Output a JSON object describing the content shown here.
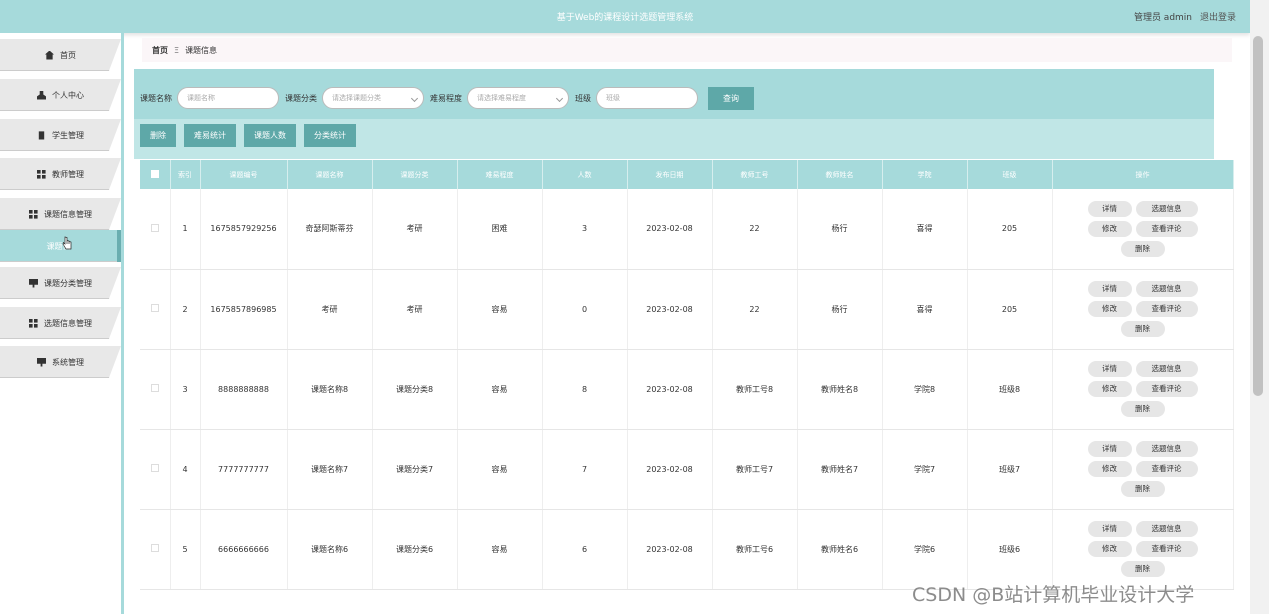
{
  "header": {
    "title": "基于Web的课程设计选题管理系统",
    "admin_label": "管理员 admin",
    "logout": "退出登录"
  },
  "sidebar": {
    "items": [
      {
        "label": "首页",
        "icon": "home-icon"
      },
      {
        "label": "个人中心",
        "icon": "user-icon"
      },
      {
        "label": "学生管理",
        "icon": "clipboard-icon"
      },
      {
        "label": "教师管理",
        "icon": "grid-icon"
      },
      {
        "label": "课题信息管理",
        "icon": "grid-icon"
      },
      {
        "label": "课题信",
        "icon": ""
      },
      {
        "label": "课题分类管理",
        "icon": "monitor-icon"
      },
      {
        "label": "选题信息管理",
        "icon": "grid-icon"
      },
      {
        "label": "系统管理",
        "icon": "monitor-icon"
      }
    ]
  },
  "breadcrumb": {
    "home": "首页",
    "sep": "Ξ",
    "current": "课题信息"
  },
  "search": {
    "name_label": "课题名称",
    "name_placeholder": "课题名称",
    "category_label": "课题分类",
    "category_placeholder": "请选择课题分类",
    "difficulty_label": "难易程度",
    "difficulty_placeholder": "请选择难易程度",
    "class_label": "班级",
    "class_placeholder": "班级",
    "query": "查询"
  },
  "actions": {
    "delete": "删除",
    "difficulty_stats": "难易统计",
    "topic_count": "课题人数",
    "category_stats": "分类统计"
  },
  "table": {
    "headers": [
      "索引",
      "课题编号",
      "课题名称",
      "课题分类",
      "难易程度",
      "人数",
      "发布日期",
      "教师工号",
      "教师姓名",
      "学院",
      "班级",
      "操作"
    ],
    "rows": [
      [
        "1",
        "1675857929256",
        "奇瑟阿斯蒂芬",
        "考研",
        "困难",
        "3",
        "2023-02-08",
        "22",
        "杨行",
        "喜得",
        "205"
      ],
      [
        "2",
        "1675857896985",
        "考研",
        "考研",
        "容易",
        "0",
        "2023-02-08",
        "22",
        "杨行",
        "喜得",
        "205"
      ],
      [
        "3",
        "8888888888",
        "课题名称8",
        "课题分类8",
        "容易",
        "8",
        "2023-02-08",
        "教师工号8",
        "教师姓名8",
        "学院8",
        "班级8"
      ],
      [
        "4",
        "7777777777",
        "课题名称7",
        "课题分类7",
        "容易",
        "7",
        "2023-02-08",
        "教师工号7",
        "教师姓名7",
        "学院7",
        "班级7"
      ],
      [
        "5",
        "6666666666",
        "课题名称6",
        "课题分类6",
        "容易",
        "6",
        "2023-02-08",
        "教师工号6",
        "教师姓名6",
        "学院6",
        "班级6"
      ]
    ],
    "ops": {
      "detail": "详情",
      "select": "选题信息",
      "edit": "修改",
      "comments": "查看评论",
      "delete": "删除"
    }
  },
  "watermark": "CSDN @B站计算机毕业设计大学"
}
